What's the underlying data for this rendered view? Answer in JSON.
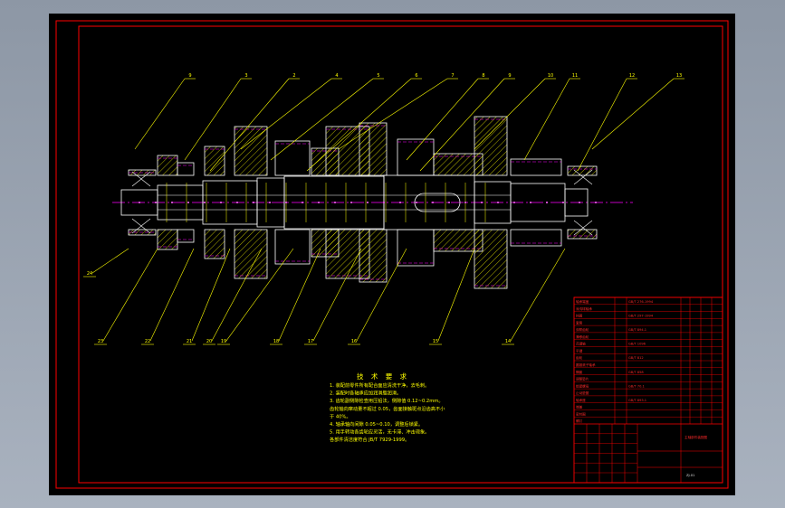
{
  "colors": {
    "background": "#000000",
    "frame": "#ff0000",
    "outline": "#ffffff",
    "hatch": "#ffff00",
    "centerline": "#ff00ff",
    "leader": "#ffff00",
    "table": "#ff0000"
  },
  "balloons_top": [
    "9",
    "3",
    "2",
    "4",
    "5",
    "6",
    "7",
    "8",
    "9",
    "10",
    "11",
    "12",
    "13"
  ],
  "balloons_bottom": [
    "24",
    "23",
    "22",
    "21",
    "20",
    "19",
    "18",
    "17",
    "16",
    "15",
    "14"
  ],
  "notes": {
    "title": "技 术 要 求",
    "lines": [
      "1. 装配前零件所有配合面应清洗干净，去毛刺。",
      "2. 装配时各轴承应加润滑脂润滑。",
      "3. 齿轮副侧隙检查用压铅法，侧隙值 0.12~0.2mm。",
      "   齿轮轴向窜动量不超过 0.05，齿面接触斑点沿齿高不小",
      "   于 40%。",
      "4. 轴承轴向间隙 0.05~0.10，调整后锁紧。",
      "5. 用手转动各齿轮应灵活，无卡滞、冲击现象。",
      "   各部件清洁度符合 JB/T 7929-1999。"
    ]
  },
  "title_block": {
    "part_rows": [
      "轴承端盖",
      "深沟球轴承",
      "挡圈",
      "套筒",
      "双联齿轮",
      "滑移齿轮",
      "花键轴",
      "平键",
      "齿轮",
      "圆锥滚子轴承",
      "隔套",
      "调整垫片",
      "锁紧螺母",
      "止动垫圈",
      "轴承座",
      "端盖",
      "密封圈",
      "螺钉"
    ],
    "codes": [
      "GB/T 276-1994",
      "GB/T 297-1994",
      "GB/T 894.1",
      "GB/T 1096",
      "GB/T 812",
      "GB/T 858",
      "GB/T 70.1",
      "GB/T 893.1"
    ],
    "drawing_name": "主轴部件装配图",
    "drawing_no": "ZJ-01"
  }
}
